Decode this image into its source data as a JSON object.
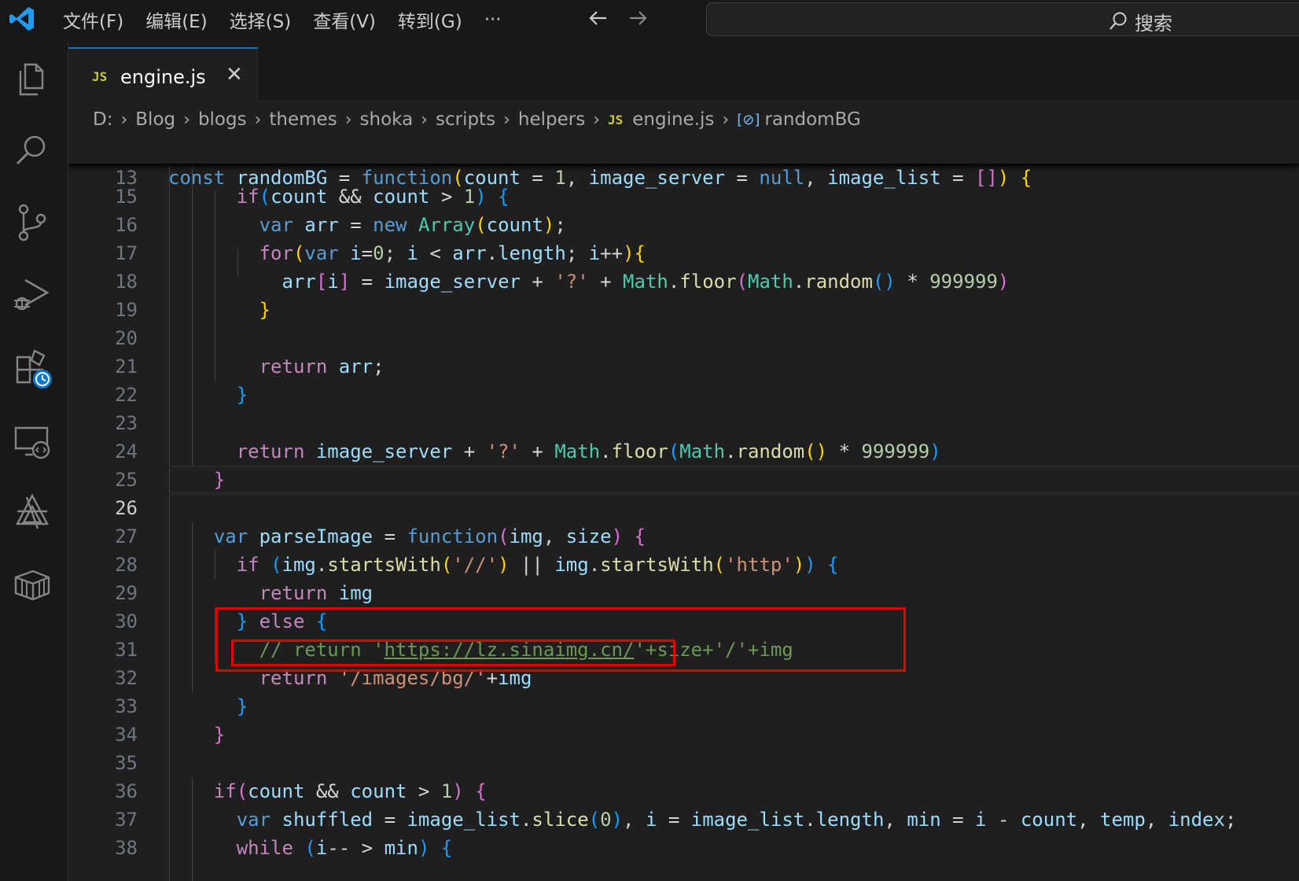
{
  "menu": [
    "文件(F)",
    "编辑(E)",
    "选择(S)",
    "查看(V)",
    "转到(G)",
    "···"
  ],
  "search": {
    "label": "搜索"
  },
  "tab": {
    "icon": "JS",
    "name": "engine.js",
    "close": "✕"
  },
  "breadcrumb": {
    "items": [
      "D:",
      "Blog",
      "blogs",
      "themes",
      "shoka",
      "scripts",
      "helpers"
    ],
    "file_icon": "JS",
    "file": "engine.js",
    "symbol": "randomBG"
  },
  "line_numbers": [
    "13",
    "15",
    "16",
    "17",
    "18",
    "19",
    "20",
    "21",
    "22",
    "23",
    "24",
    "25",
    "26",
    "27",
    "28",
    "29",
    "30",
    "31",
    "32",
    "33",
    "34",
    "35",
    "36",
    "37",
    "38"
  ],
  "colors": {
    "accent": "#0078d4",
    "highlight_box": "#e00000",
    "js_icon": "#cbcb41"
  },
  "icons": [
    "vscode-logo-icon",
    "back-arrow-icon",
    "forward-arrow-icon",
    "search-icon",
    "explorer-icon",
    "search-view-icon",
    "source-control-icon",
    "run-debug-icon",
    "extensions-icon",
    "remote-explorer-icon",
    "deploy-icon",
    "package-icon"
  ]
}
